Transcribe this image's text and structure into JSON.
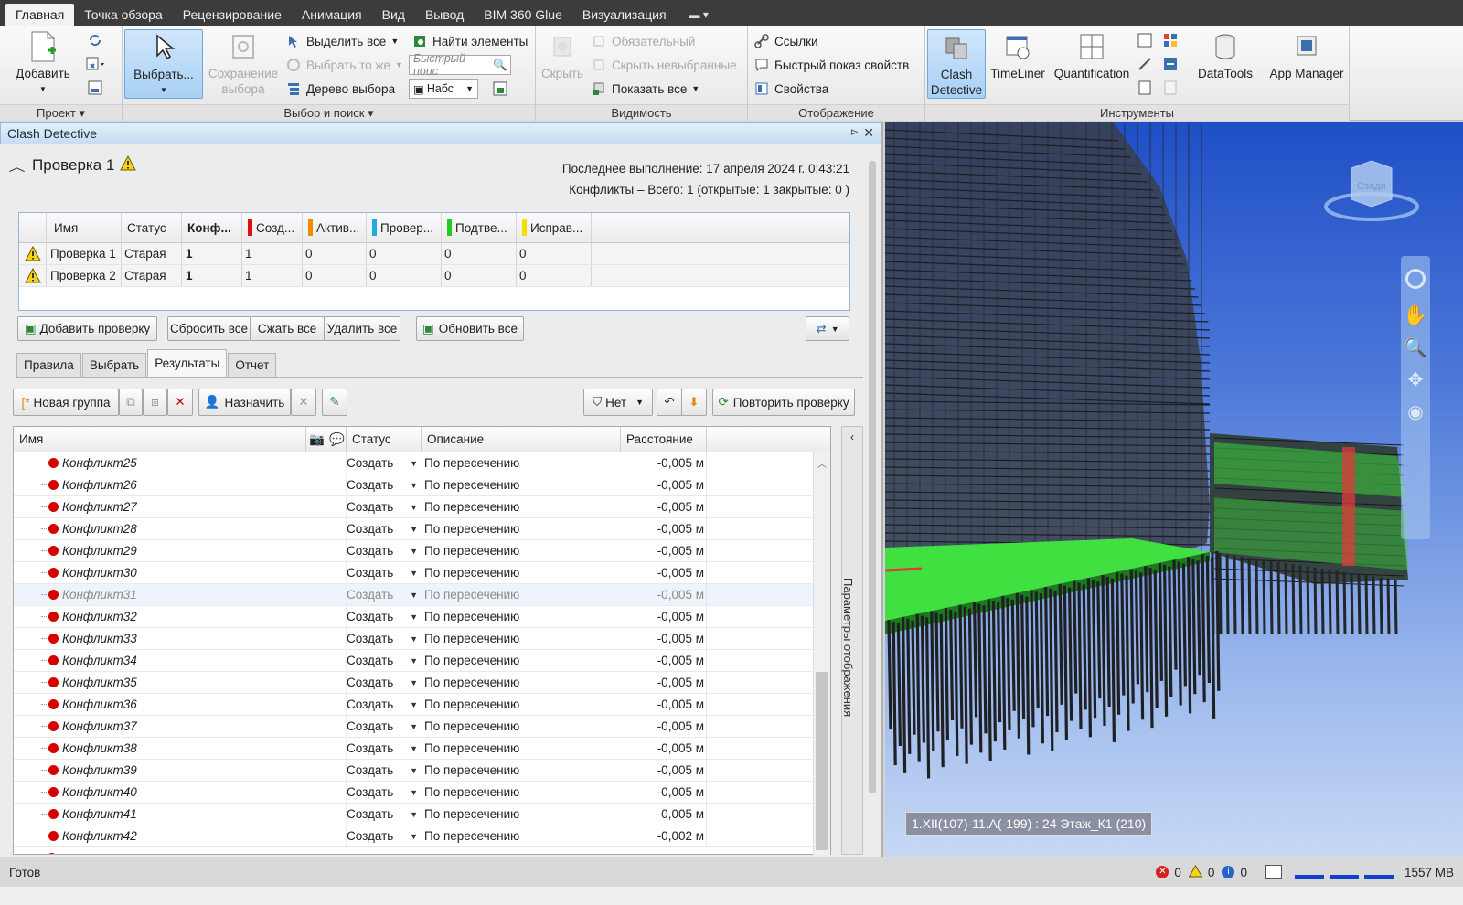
{
  "menubar": {
    "tabs": [
      "Главная",
      "Точка обзора",
      "Рецензирование",
      "Анимация",
      "Вид",
      "Вывод",
      "BIM 360 Glue",
      "Визуализация"
    ]
  },
  "ribbon": {
    "project": {
      "label": "Проект",
      "add": "Добавить"
    },
    "select": {
      "label": "Выбор и поиск",
      "select_btn": "Выбрать...",
      "save_selection": "Сохранение выбора",
      "select_all": "Выделить все",
      "select_same": "Выбрать то же",
      "selection_tree": "Дерево выбора",
      "find_items": "Найти элементы",
      "quick_find_placeholder": "Быстрый поис",
      "sets": "Набс"
    },
    "visibility": {
      "label": "Видимость",
      "hide": "Скрыть",
      "required": "Обязательный",
      "hide_unselected": "Скрыть невыбранные",
      "show_all": "Показать все"
    },
    "display": {
      "label": "Отображение",
      "links": "Ссылки",
      "quick_properties": "Быстрый  показ свойств",
      "properties": "Свойства"
    },
    "tools": {
      "label": "Инструменты",
      "clash_detective": "Clash Detective",
      "timeliner": "TimeLiner",
      "quantification": "Quantification",
      "datatools": "DataTools",
      "app_manager": "App Manager"
    }
  },
  "panel": {
    "title": "Clash Detective",
    "test_name": "Проверка 1",
    "last_run": "Последнее выполнение:  17 апреля 2024 г. 0:43:21",
    "conflicts_summary": "Конфликты –  Всего:  1  (открытые:  1  закрытые:  0 )",
    "tests_table": {
      "headers": [
        "Имя",
        "Статус",
        "Конф...",
        "Созд...",
        "Актив...",
        "Провер...",
        "Подтве...",
        "Исправ..."
      ],
      "rows": [
        [
          "Проверка 1",
          "Старая",
          "1",
          "1",
          "0",
          "0",
          "0",
          "0"
        ],
        [
          "Проверка 2",
          "Старая",
          "1",
          "1",
          "0",
          "0",
          "0",
          "0"
        ]
      ]
    },
    "buttons": {
      "add_test": "Добавить проверку",
      "reset_all": "Сбросить все",
      "compact_all": "Сжать все",
      "delete_all": "Удалить все",
      "update_all": "Обновить все"
    },
    "tabs": [
      "Правила",
      "Выбрать",
      "Результаты",
      "Отчет"
    ],
    "toolbar": {
      "new_group": "Новая группа",
      "assign": "Назначить",
      "filter_value": "Нет",
      "rerun": "Повторить проверку"
    },
    "results": {
      "headers": [
        "Имя",
        "Статус",
        "Описание",
        "Расстояние"
      ],
      "rows": [
        [
          "Конфликт25",
          "Создать",
          "По пересечению",
          "-0,005 м"
        ],
        [
          "Конфликт26",
          "Создать",
          "По пересечению",
          "-0,005 м"
        ],
        [
          "Конфликт27",
          "Создать",
          "По пересечению",
          "-0,005 м"
        ],
        [
          "Конфликт28",
          "Создать",
          "По пересечению",
          "-0,005 м"
        ],
        [
          "Конфликт29",
          "Создать",
          "По пересечению",
          "-0,005 м"
        ],
        [
          "Конфликт30",
          "Создать",
          "По пересечению",
          "-0,005 м"
        ],
        [
          "Конфликт31",
          "Создать",
          "По пересечению",
          "-0,005 м"
        ],
        [
          "Конфликт32",
          "Создать",
          "По пересечению",
          "-0,005 м"
        ],
        [
          "Конфликт33",
          "Создать",
          "По пересечению",
          "-0,005 м"
        ],
        [
          "Конфликт34",
          "Создать",
          "По пересечению",
          "-0,005 м"
        ],
        [
          "Конфликт35",
          "Создать",
          "По пересечению",
          "-0,005 м"
        ],
        [
          "Конфликт36",
          "Создать",
          "По пересечению",
          "-0,005 м"
        ],
        [
          "Конфликт37",
          "Создать",
          "По пересечению",
          "-0,005 м"
        ],
        [
          "Конфликт38",
          "Создать",
          "По пересечению",
          "-0,005 м"
        ],
        [
          "Конфликт39",
          "Создать",
          "По пересечению",
          "-0,005 м"
        ],
        [
          "Конфликт40",
          "Создать",
          "По пересечению",
          "-0,005 м"
        ],
        [
          "Конфликт41",
          "Создать",
          "По пересечению",
          "-0,005 м"
        ],
        [
          "Конфликт42",
          "Создать",
          "По пересечению",
          "-0,002 м"
        ]
      ]
    },
    "side_label": "Параметры отображения"
  },
  "viewport": {
    "tooltip": "1.XII(107)-11.A(-199) : 24 Этаж_К1 (210)",
    "viewcube_face": "Сзади"
  },
  "statusbar": {
    "text": "Готов",
    "errors": "0",
    "warnings": "0",
    "infos": "0",
    "memory": "1557 MB"
  },
  "colors": {
    "status_new": "#e01010",
    "status_active": "#f08c00",
    "status_reviewed": "#22aadd",
    "status_approved": "#22cc22",
    "status_resolved": "#f0e000",
    "clash_dot": "#d40000"
  }
}
